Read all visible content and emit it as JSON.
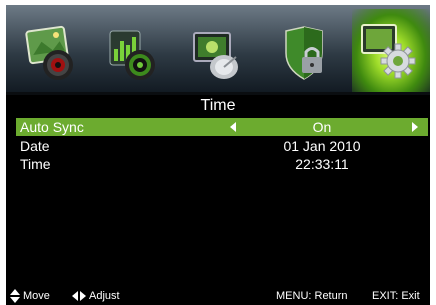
{
  "tabs": [
    {
      "icon": "picture-icon",
      "active": false
    },
    {
      "icon": "sound-icon",
      "active": false
    },
    {
      "icon": "channel-icon",
      "active": false
    },
    {
      "icon": "lock-icon",
      "active": false
    },
    {
      "icon": "setup-gear-icon",
      "active": true
    }
  ],
  "menu": {
    "title": "Time",
    "rows": [
      {
        "label": "Auto Sync",
        "value": "On",
        "selected": true
      },
      {
        "label": "Date",
        "value": "01 Jan 2010",
        "selected": false
      },
      {
        "label": "Time",
        "value": "22:33:11",
        "selected": false
      }
    ]
  },
  "footer": {
    "move": "Move",
    "adjust": "Adjust",
    "menu_return": "MENU: Return",
    "exit": "EXIT: Exit"
  },
  "colors": {
    "selected_row": "#6cab2f",
    "active_tab_glow": "#9fdc2a",
    "background": "#000000"
  }
}
